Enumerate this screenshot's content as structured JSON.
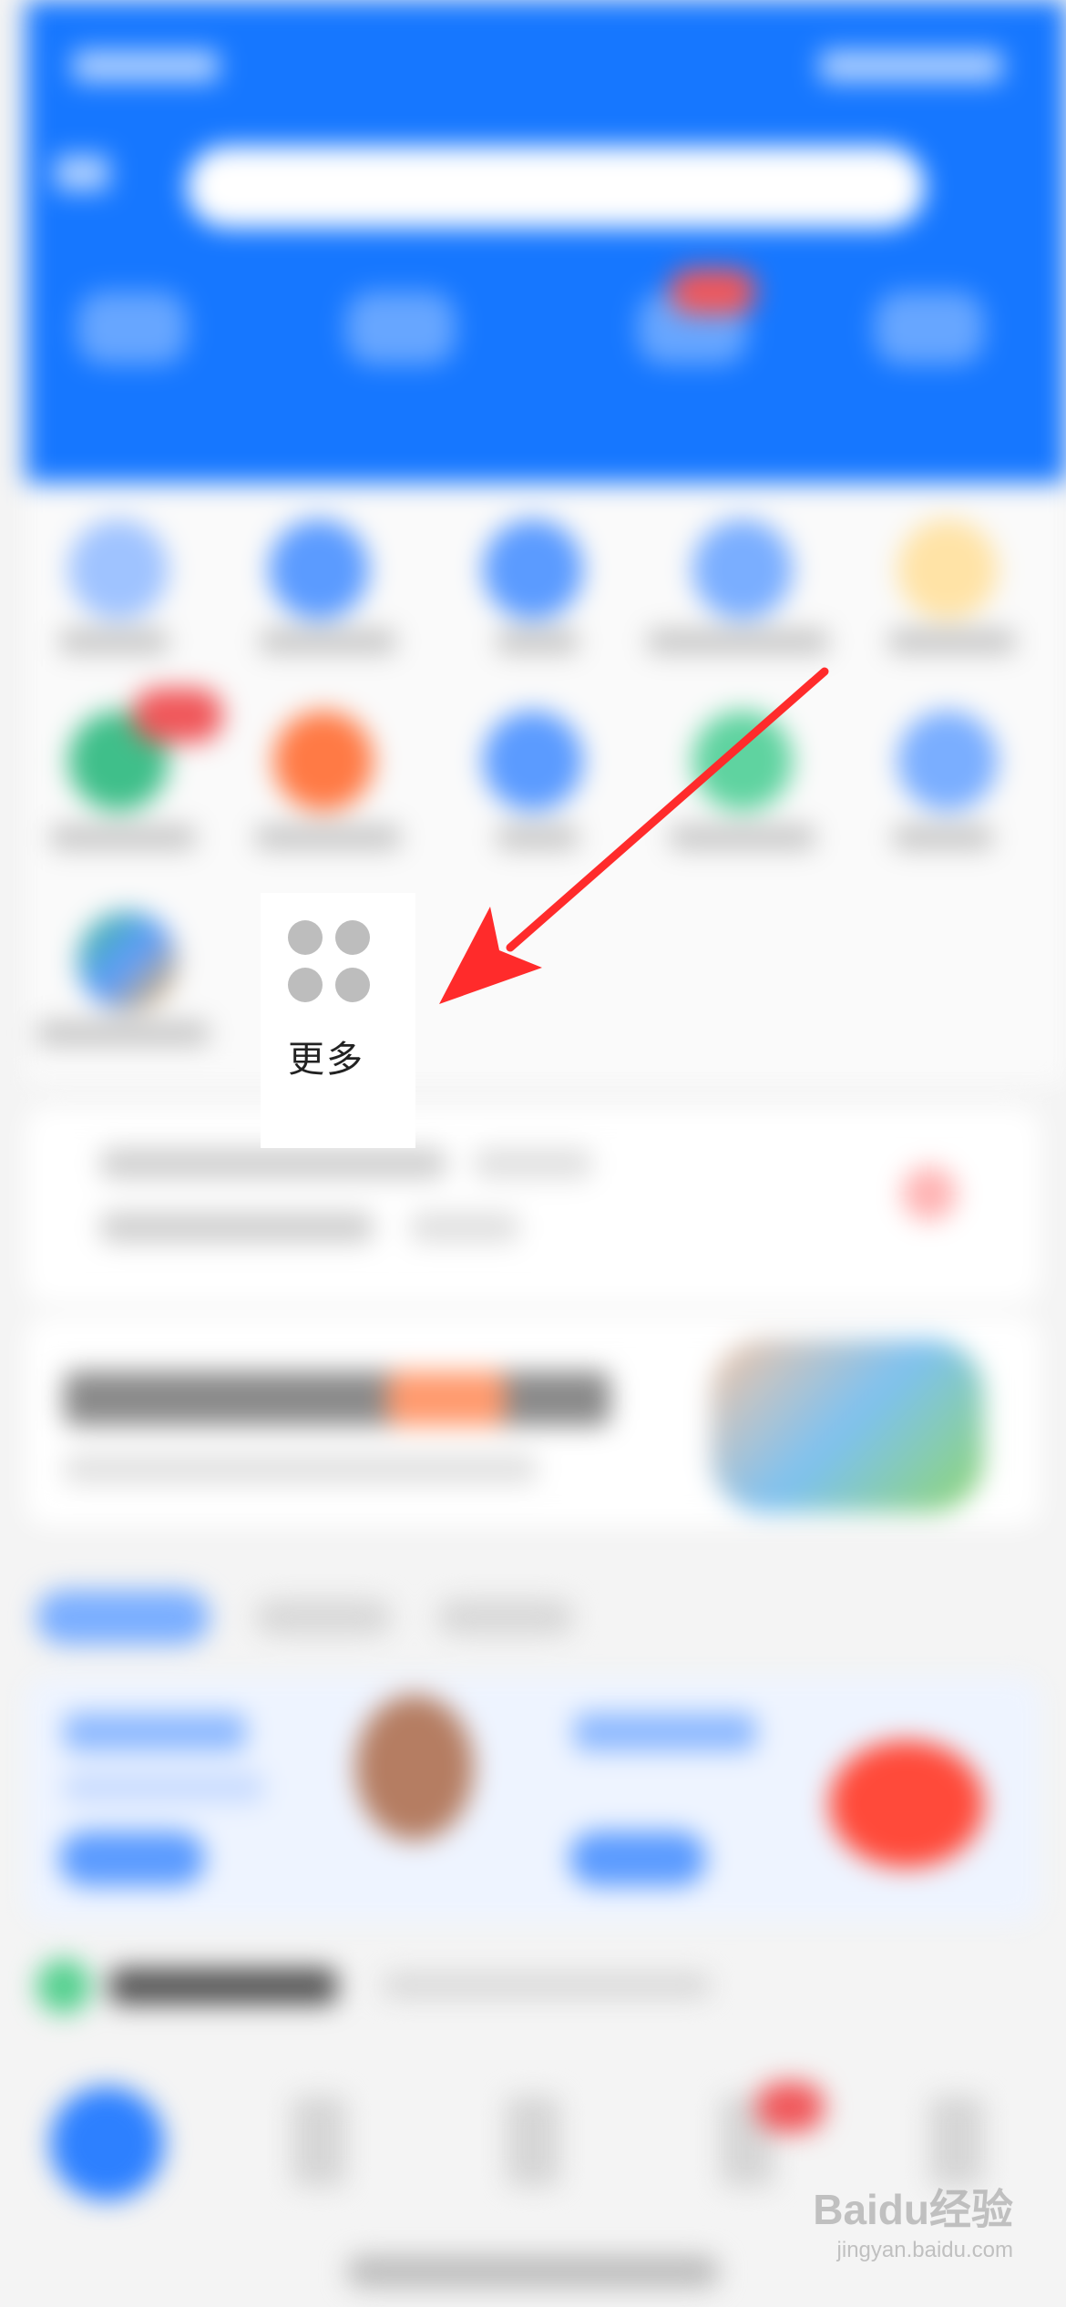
{
  "more_tile": {
    "label": "更多",
    "icon": "four-dots-grid-icon"
  },
  "annotation": {
    "color": "#ff2b2b",
    "points_to": "more-tile"
  },
  "watermark": {
    "main": "Baidu经验",
    "sub": "jingyan.baidu.com"
  },
  "colors": {
    "header_blue": "#1677ff",
    "background": "#f4f4f4",
    "arrow_red": "#ff2b2b"
  }
}
